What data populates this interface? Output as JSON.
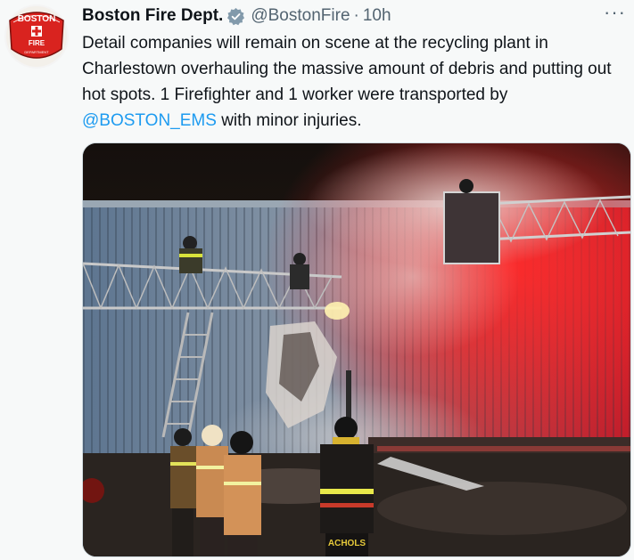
{
  "tweet": {
    "avatar_icon": "boston-fire-department-logo",
    "avatar_text": "BOSTON FIRE DEPARTMENT",
    "display_name": "Boston Fire Dept.",
    "verified_icon": "verified-badge-icon",
    "handle": "@BostonFire",
    "separator": "·",
    "time": "10h",
    "more_icon": "more-options-icon",
    "text_before": "Detail companies will remain on scene at the recycling plant in Charlestown overhauling the massive amount of debris and putting out hot spots. 1 Firefighter and 1 worker were transported by ",
    "mention": "@BOSTON_EMS",
    "text_after": " with minor injuries.",
    "media": {
      "description_icon": "fire-scene-photo",
      "helmet_text": "ACHOLS"
    },
    "colors": {
      "mention": "#1d9bf0",
      "secondary_text": "#536471",
      "verified": "#1d9bf0",
      "logo_red": "#d9231f"
    }
  }
}
